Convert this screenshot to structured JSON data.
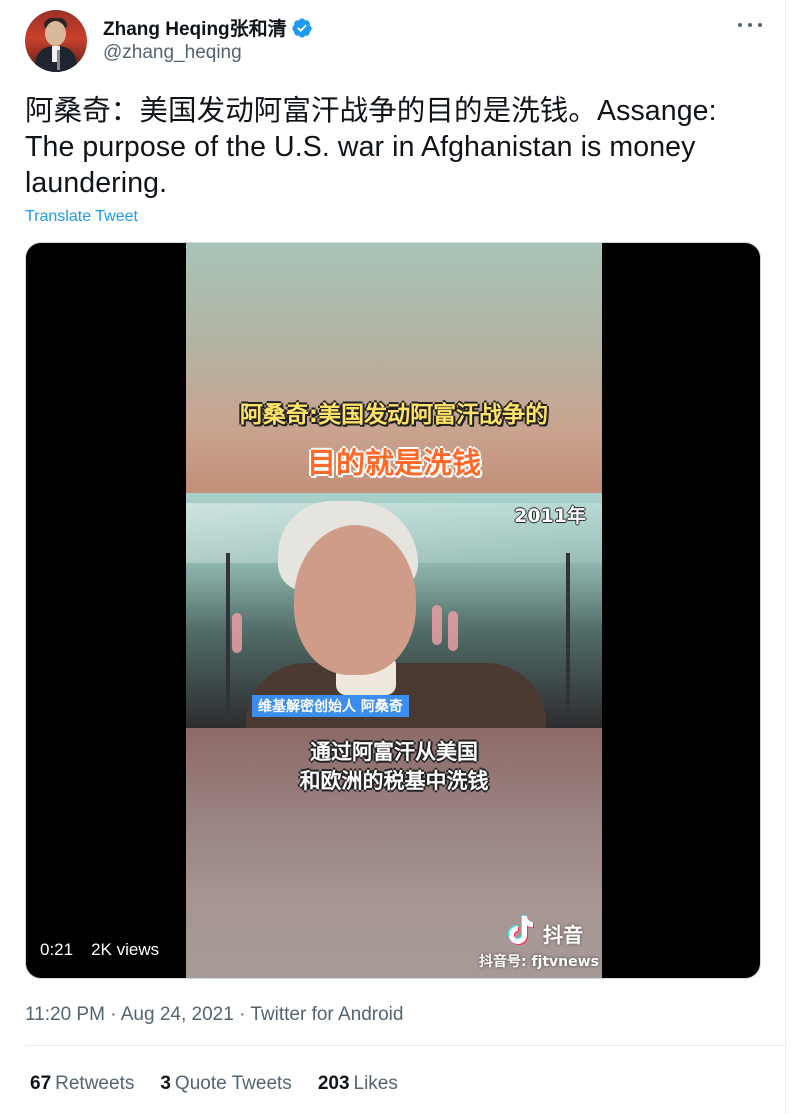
{
  "author": {
    "name": "Zhang Heqing张和清",
    "handle": "@zhang_heqing",
    "verified_icon": "verified-badge-icon"
  },
  "tweet": {
    "text": "阿桑奇：美国发动阿富汗战争的目的是洗钱。Assange: The purpose of the U.S. war in Afghanistan is money laundering.",
    "translate_label": "Translate Tweet"
  },
  "video": {
    "caption_line1": "阿桑奇:美国发动阿富汗战争的",
    "caption_line2": "目的就是洗钱",
    "year_label": "2011年",
    "name_tag": "维基解密创始人 阿桑奇",
    "subtitle_line1": "通过阿富汗从美国",
    "subtitle_line2": "和欧洲的税基中洗钱",
    "watermark_brand": "抖音",
    "watermark_id": "抖音号: fjtvnews",
    "duration": "0:21",
    "views": "2K views"
  },
  "meta": {
    "timestamp": "11:20 PM · Aug 24, 2021 · Twitter for Android"
  },
  "stats": {
    "retweets_count": "67",
    "retweets_label": "Retweets",
    "quotes_count": "3",
    "quotes_label": "Quote Tweets",
    "likes_count": "203",
    "likes_label": "Likes"
  },
  "colors": {
    "link": "#1d9bf0",
    "secondary_text": "#536471",
    "verified": "#1d9bf0"
  }
}
